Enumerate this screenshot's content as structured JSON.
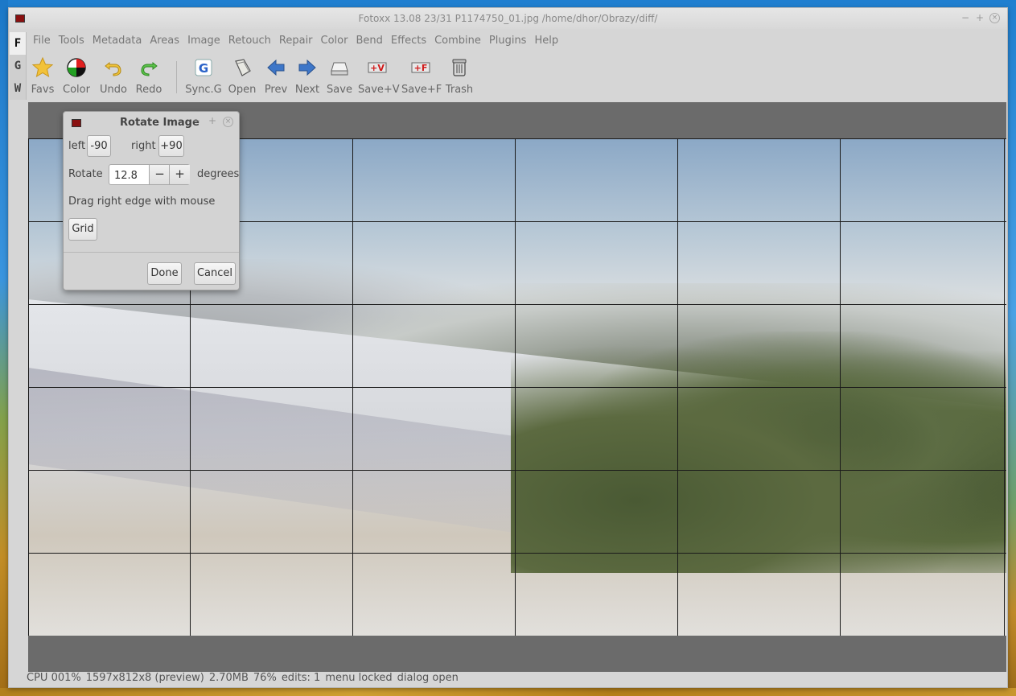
{
  "window": {
    "title": "Fotoxx 13.08  23/31  P1174750_01.jpg  /home/dhor/Obrazy/diff/",
    "controls": [
      "−",
      "+",
      "×"
    ]
  },
  "side_tabs": [
    "F",
    "G",
    "W"
  ],
  "menu": [
    "File",
    "Tools",
    "Metadata",
    "Areas",
    "Image",
    "Retouch",
    "Repair",
    "Color",
    "Bend",
    "Effects",
    "Combine",
    "Plugins",
    "Help"
  ],
  "toolbar": [
    {
      "label": "Favs",
      "icon": "star-icon"
    },
    {
      "label": "Color",
      "icon": "color-wheel-icon"
    },
    {
      "label": "Undo",
      "icon": "undo-arrow-icon"
    },
    {
      "label": "Redo",
      "icon": "redo-arrow-icon"
    },
    {
      "label": "Sync.G",
      "icon": "sync-g-icon"
    },
    {
      "label": "Open",
      "icon": "open-folder-icon"
    },
    {
      "label": "Prev",
      "icon": "left-arrow-icon"
    },
    {
      "label": "Next",
      "icon": "right-arrow-icon"
    },
    {
      "label": "Save",
      "icon": "drive-icon"
    },
    {
      "label": "Save+V",
      "icon": "save-version-icon"
    },
    {
      "label": "Save+F",
      "icon": "save-file-icon"
    },
    {
      "label": "Trash",
      "icon": "trash-icon"
    }
  ],
  "status": {
    "cpu": "CPU 001%",
    "size": "1597x812x8 (preview)",
    "mem": "2.70MB",
    "zoom": "76%",
    "edits": "edits: 1",
    "menu": "menu locked",
    "dialog": "dialog open"
  },
  "dialog": {
    "title": "Rotate Image",
    "left_label": "left",
    "left_button": "-90",
    "right_label": "right",
    "right_button": "+90",
    "rotate_label": "Rotate",
    "rotate_value": "12.8",
    "minus": "−",
    "plus": "+",
    "degrees_label": "degrees",
    "hint": "Drag right edge with mouse",
    "grid_button": "Grid",
    "done_button": "Done",
    "cancel_button": "Cancel"
  },
  "colors": {
    "window_bg": "#d6d6d6",
    "canvas_bg": "#6b6b6b",
    "app_icon": "#8a1010"
  }
}
